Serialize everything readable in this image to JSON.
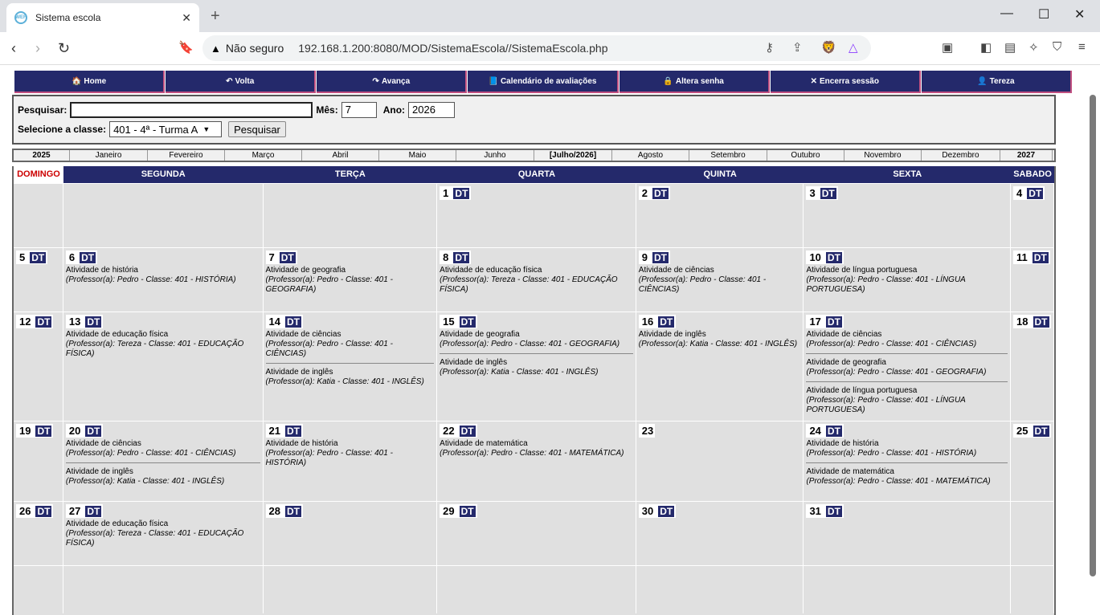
{
  "browser": {
    "tab_title": "Sistema escola",
    "favicon_text": "WEF",
    "not_secure": "Não seguro",
    "url": "192.168.1.200:8080/MOD/SistemaEscola//SistemaEscola.php"
  },
  "menu": [
    {
      "label": "Home",
      "icon": "🏠"
    },
    {
      "label": "Volta",
      "icon": "↶"
    },
    {
      "label": "Avança",
      "icon": "↷"
    },
    {
      "label": "Calendário de avaliações",
      "icon": "📘"
    },
    {
      "label": "Altera senha",
      "icon": "🔒"
    },
    {
      "label": "Encerra sessão",
      "icon": "✕"
    },
    {
      "label": "Tereza",
      "icon": "👤"
    }
  ],
  "search": {
    "label": "Pesquisar:",
    "mes_label": "Mês:",
    "mes_value": "7",
    "ano_label": "Ano:",
    "ano_value": "2026",
    "classe_label": "Selecione a classe:",
    "classe_value": "401 - 4ª - Turma A",
    "button": "Pesquisar"
  },
  "months": [
    {
      "t": "2025",
      "b": true,
      "w": 70
    },
    {
      "t": "Janeiro",
      "w": 97
    },
    {
      "t": "Fevereiro",
      "w": 96
    },
    {
      "t": "Março",
      "w": 96
    },
    {
      "t": "Abril",
      "w": 96
    },
    {
      "t": "Maio",
      "w": 96
    },
    {
      "t": "Junho",
      "w": 97
    },
    {
      "t": "[Julho/2026]",
      "b": true,
      "w": 97
    },
    {
      "t": "Agosto",
      "w": 96
    },
    {
      "t": "Setembro",
      "w": 97
    },
    {
      "t": "Outubro",
      "w": 96
    },
    {
      "t": "Novembro",
      "w": 96
    },
    {
      "t": "Dezembro",
      "w": 98
    },
    {
      "t": "2027",
      "b": true,
      "w": 65
    }
  ],
  "weekdays": [
    "DOMINGO",
    "SEGUNDA",
    "TERÇA",
    "QUARTA",
    "QUINTA",
    "SEXTA",
    "SABADO"
  ],
  "dt_label": "DT",
  "weeks": [
    [
      null,
      null,
      null,
      {
        "d": "1"
      },
      {
        "d": "2"
      },
      {
        "d": "3"
      },
      {
        "d": "4"
      }
    ],
    [
      {
        "d": "5"
      },
      {
        "d": "6",
        "ev": [
          [
            "Atividade de história",
            "(Professor(a): Pedro - Classe: 401 - HISTÓRIA)"
          ]
        ]
      },
      {
        "d": "7",
        "ev": [
          [
            "Atividade de geografia",
            "(Professor(a): Pedro - Classe: 401 - GEOGRAFIA)"
          ]
        ]
      },
      {
        "d": "8",
        "ev": [
          [
            "Atividade de educação física",
            "(Professor(a): Tereza - Classe: 401 - EDUCAÇÃO FÍSICA)"
          ]
        ]
      },
      {
        "d": "9",
        "ev": [
          [
            "Atividade de ciências",
            "(Professor(a): Pedro - Classe: 401 - CIÊNCIAS)"
          ]
        ]
      },
      {
        "d": "10",
        "ev": [
          [
            "Atividade de língua portuguesa",
            "(Professor(a): Pedro - Classe: 401 - LÍNGUA PORTUGUESA)"
          ]
        ]
      },
      {
        "d": "11"
      }
    ],
    [
      {
        "d": "12"
      },
      {
        "d": "13",
        "ev": [
          [
            "Atividade de educação física",
            "(Professor(a): Tereza - Classe: 401 - EDUCAÇÃO FÍSICA)"
          ]
        ]
      },
      {
        "d": "14",
        "ev": [
          [
            "Atividade de ciências",
            "(Professor(a): Pedro - Classe: 401 - CIÊNCIAS)"
          ],
          [
            "Atividade de inglês",
            "(Professor(a): Katia - Classe: 401 - INGLÊS)"
          ]
        ]
      },
      {
        "d": "15",
        "ev": [
          [
            "Atividade de geografia",
            "(Professor(a): Pedro - Classe: 401 - GEOGRAFIA)"
          ],
          [
            "Atividade de inglês",
            "(Professor(a): Katia - Classe: 401 - INGLÊS)"
          ]
        ]
      },
      {
        "d": "16",
        "ev": [
          [
            "Atividade de inglês",
            "(Professor(a): Katia - Classe: 401 - INGLÊS)"
          ]
        ]
      },
      {
        "d": "17",
        "ev": [
          [
            "Atividade de ciências",
            "(Professor(a): Pedro - Classe: 401 - CIÊNCIAS)"
          ],
          [
            "Atividade de geografia",
            "(Professor(a): Pedro - Classe: 401 - GEOGRAFIA)"
          ],
          [
            "Atividade de língua portuguesa",
            "(Professor(a): Pedro - Classe: 401 - LÍNGUA PORTUGUESA)"
          ]
        ]
      },
      {
        "d": "18"
      }
    ],
    [
      {
        "d": "19"
      },
      {
        "d": "20",
        "ev": [
          [
            "Atividade de ciências",
            "(Professor(a): Pedro - Classe: 401 - CIÊNCIAS)"
          ],
          [
            "Atividade de inglês",
            "(Professor(a): Katia - Classe: 401 - INGLÊS)"
          ]
        ]
      },
      {
        "d": "21",
        "ev": [
          [
            "Atividade de história",
            "(Professor(a): Pedro - Classe: 401 - HISTÓRIA)"
          ]
        ]
      },
      {
        "d": "22",
        "ev": [
          [
            "Atividade de matemática",
            "(Professor(a): Pedro - Classe: 401 - MATEMÁTICA)"
          ]
        ]
      },
      {
        "d": "23",
        "nodt": true
      },
      {
        "d": "24",
        "ev": [
          [
            "Atividade de história",
            "(Professor(a): Pedro - Classe: 401 - HISTÓRIA)"
          ],
          [
            "Atividade de matemática",
            "(Professor(a): Pedro - Classe: 401 - MATEMÁTICA)"
          ]
        ]
      },
      {
        "d": "25"
      }
    ],
    [
      {
        "d": "26"
      },
      {
        "d": "27",
        "ev": [
          [
            "Atividade de educação física",
            "(Professor(a): Tereza - Classe: 401 - EDUCAÇÃO FÍSICA)"
          ]
        ]
      },
      {
        "d": "28"
      },
      {
        "d": "29"
      },
      {
        "d": "30"
      },
      {
        "d": "31"
      },
      null
    ],
    [
      null,
      null,
      null,
      null,
      null,
      null,
      null
    ]
  ]
}
